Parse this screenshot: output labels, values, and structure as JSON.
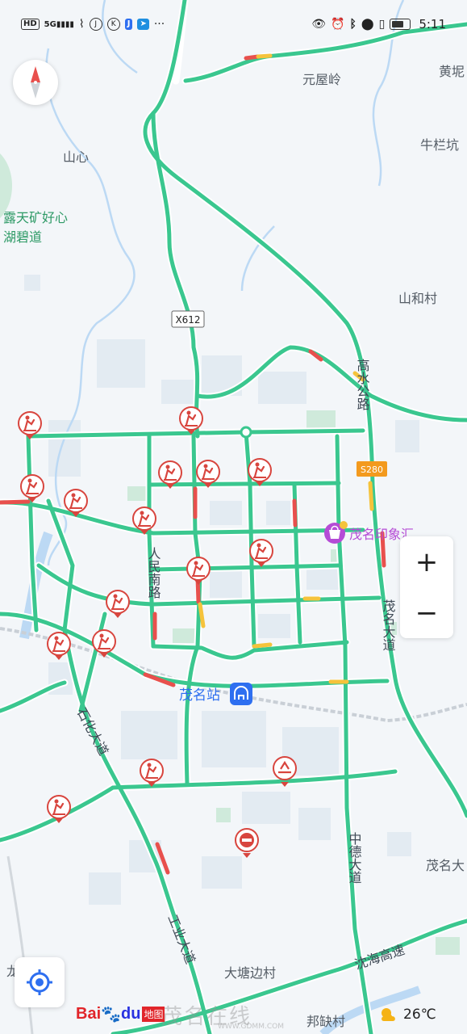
{
  "status_bar": {
    "left_icons": [
      "HD",
      "5G signal",
      "wifi-calling",
      "JDM",
      "K",
      "JDM",
      "send"
    ],
    "hd_label": "HD",
    "dots": "···",
    "time": "5:11"
  },
  "colors": {
    "road": "#3ac78f",
    "road_outline": "#ffffff",
    "congestion": "#e8504d",
    "slow": "#f5c33b",
    "water": "#bcd9f4",
    "green_area": "#cfeadb",
    "building": "#e4ecf3",
    "rail": "#c9cfd6",
    "station": "#2e6ff0",
    "poi_pink": "#b54cd6",
    "work_pin": "#d8453e"
  },
  "map_labels": {
    "yuanwuling": "元屋岭",
    "huangkeng": "黄坭",
    "niulankeng": "牛栏坑",
    "shanxin": "山心",
    "lutian_line1": "露天矿好心",
    "lutian_line2": "湖碧道",
    "shanhecun": "山和村",
    "x612": "X612",
    "gaoshui_road": "高水公路",
    "s280": "S280",
    "maoming_yinxiang": "茂名印象汇",
    "renmin_south": "人民南路",
    "maoming_avenue": "茂名大道",
    "maoming_station": "茂名站",
    "shihua_avenue": "石化大道",
    "zhongde_avenue": "中德大道",
    "maoming_right": "茂名大",
    "industrial_avenue": "工业大道",
    "shenhai_expressway": "沈海高速",
    "longlingpo": "龙坡坡",
    "datangbian": "大塘边村",
    "bangquecun": "邦缺村"
  },
  "controls": {
    "zoom_in": "+",
    "zoom_out": "−"
  },
  "branding": {
    "logo_bai": "Bai",
    "logo_du": "du",
    "logo_map": "地图"
  },
  "weather": {
    "temperature": "26℃",
    "icon": "cloud-sun-icon"
  },
  "watermark": {
    "text": "茂名在线",
    "url": "WWW.GDMM.COM"
  }
}
